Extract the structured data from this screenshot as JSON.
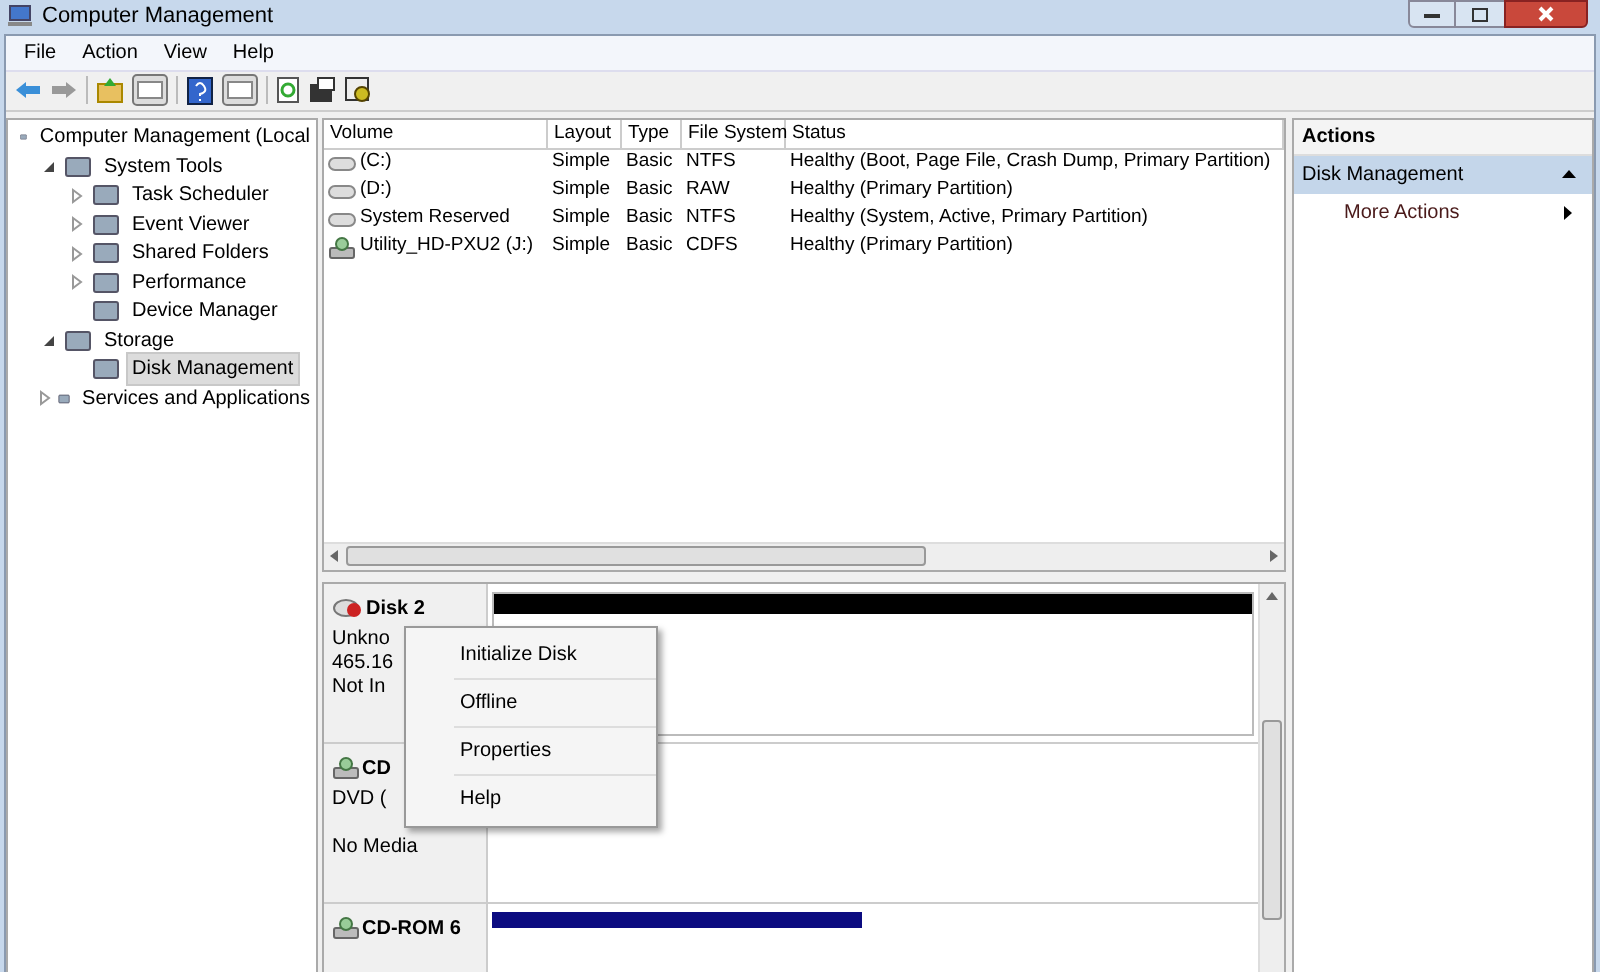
{
  "window": {
    "title": "Computer Management"
  },
  "menu": [
    "File",
    "Action",
    "View",
    "Help"
  ],
  "tree": [
    {
      "label": "Computer Management (Local",
      "selected": false,
      "children": [
        {
          "label": "System Tools",
          "expanded": true,
          "selected": false,
          "children": [
            {
              "label": "Task Scheduler",
              "expanded": false,
              "selected": false
            },
            {
              "label": "Event Viewer",
              "expanded": false,
              "selected": false
            },
            {
              "label": "Shared Folders",
              "expanded": false,
              "selected": false
            },
            {
              "label": "Performance",
              "expanded": false,
              "selected": false
            },
            {
              "label": "Device Manager",
              "selected": false
            }
          ]
        },
        {
          "label": "Storage",
          "expanded": true,
          "selected": false,
          "children": [
            {
              "label": "Disk Management",
              "selected": true
            }
          ]
        },
        {
          "label": "Services and Applications",
          "expanded": false,
          "selected": false
        }
      ]
    }
  ],
  "table": {
    "columns": [
      "Volume",
      "Layout",
      "Type",
      "File System",
      "Status"
    ],
    "rows": [
      {
        "kind": "drive",
        "cells": [
          "(C:)",
          "Simple",
          "Basic",
          "NTFS",
          "Healthy (Boot, Page File, Crash Dump, Primary Partition)"
        ]
      },
      {
        "kind": "drive",
        "cells": [
          "(D:)",
          "Simple",
          "Basic",
          "RAW",
          "Healthy (Primary Partition)"
        ]
      },
      {
        "kind": "drive",
        "cells": [
          "System Reserved",
          "Simple",
          "Basic",
          "NTFS",
          "Healthy (System, Active, Primary Partition)"
        ]
      },
      {
        "kind": "optical",
        "cells": [
          "Utility_HD-PXU2 (J:)",
          "Simple",
          "Basic",
          "CDFS",
          "Healthy (Primary Partition)"
        ]
      }
    ]
  },
  "disks": [
    {
      "kind": "disk",
      "name": "Disk 2",
      "lines": [
        "Unkno",
        "465.16",
        "Not In"
      ]
    },
    {
      "kind": "optical",
      "name": "CD",
      "lines": [
        "DVD (",
        "No Media"
      ]
    },
    {
      "kind": "optical",
      "name": "CD-ROM 6"
    }
  ],
  "context_menu": [
    "Initialize Disk",
    "Offline",
    "Properties",
    "Help"
  ],
  "actions": {
    "title": "Actions",
    "section": "Disk Management",
    "items": [
      "More Actions"
    ]
  }
}
